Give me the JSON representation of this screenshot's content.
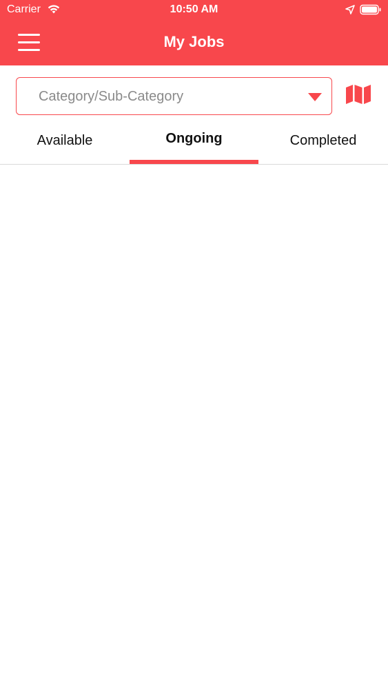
{
  "status_bar": {
    "carrier": "Carrier",
    "time": "10:50 AM"
  },
  "nav": {
    "title": "My Jobs",
    "menu_icon": "hamburger-menu-icon"
  },
  "category_filter": {
    "placeholder": "Category/Sub-Category",
    "arrow_icon": "caret-down-icon"
  },
  "map_button": {
    "icon": "map-icon"
  },
  "tabs": [
    {
      "label": "Available",
      "selected": false
    },
    {
      "label": "Ongoing",
      "selected": true
    },
    {
      "label": "Completed",
      "selected": false
    }
  ],
  "colors": {
    "accent": "#f8474c",
    "text": "#111111",
    "placeholder": "#8a8a8a",
    "divider": "#d9d9d9"
  }
}
